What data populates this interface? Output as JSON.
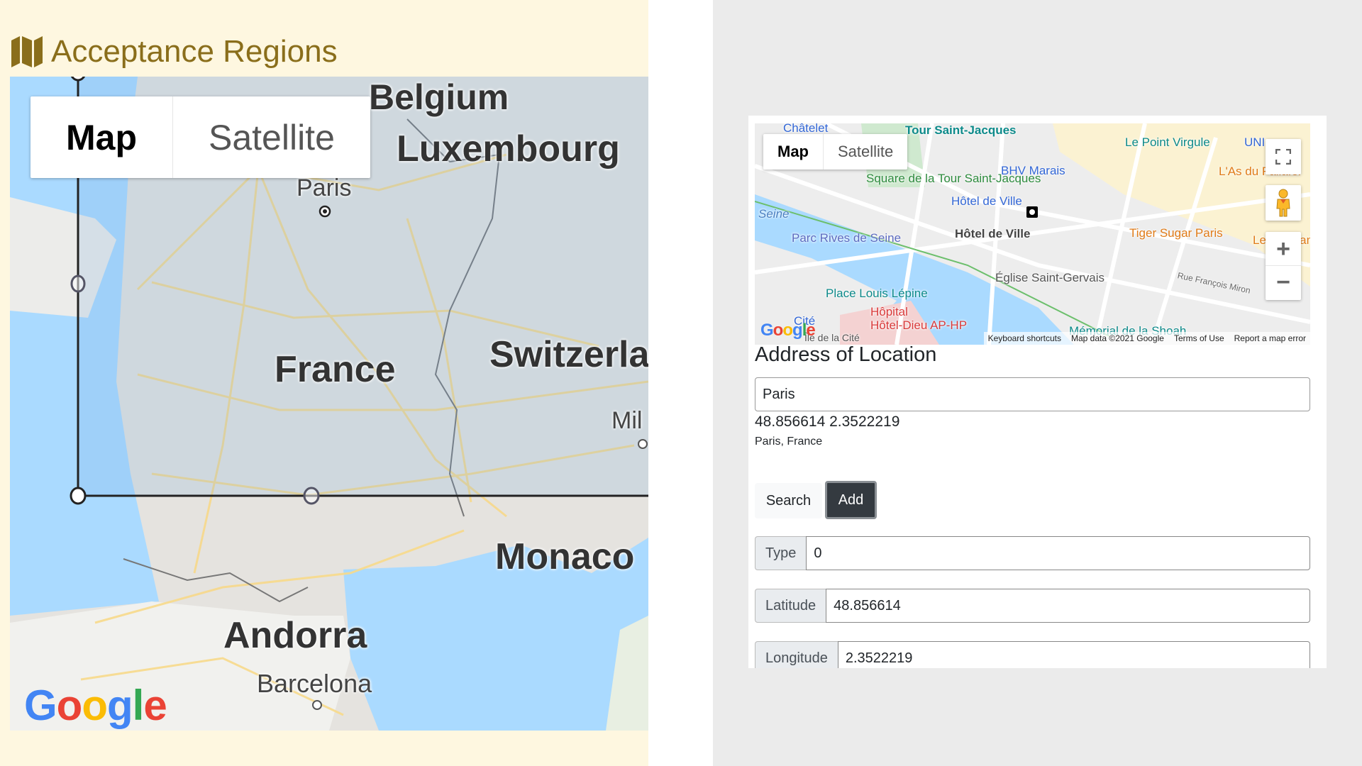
{
  "left": {
    "title": "Acceptance Regions",
    "title_icon": "map-icon",
    "map": {
      "type_buttons": [
        {
          "label": "Map",
          "active": true
        },
        {
          "label": "Satellite",
          "active": false
        }
      ],
      "labels": {
        "belgium": "Belgium",
        "luxembourg": "Luxembourg",
        "paris": "Paris",
        "france": "France",
        "switzerland": "Switzerlar",
        "milan": "Mil",
        "monaco": "Monaco",
        "andorra": "Andorra",
        "barcelona": "Barcelona"
      },
      "google_logo": [
        "G",
        "o",
        "o",
        "g",
        "l",
        "e"
      ]
    }
  },
  "right": {
    "map": {
      "type_buttons": [
        {
          "label": "Map",
          "active": true
        },
        {
          "label": "Satellite",
          "active": false
        }
      ],
      "pois": {
        "chatelet": "Châtelet",
        "tour_saint_jacques": "Tour Saint-Jacques",
        "square_tour": "Square de la Tour Saint-Jacques",
        "bhv": "BHV Marais",
        "point_virgule": "Le Point Virgule",
        "uniqlo": "UNI",
        "as_fallafel": "L'As du Fallafel",
        "hotel_ville_metro": "Hôtel de Ville",
        "hotel_ville": "Hôtel de Ville",
        "seine": "Seine",
        "parc_rives": "Parc Rives de Seine",
        "tiger_sugar": "Tiger Sugar Paris",
        "loir": "Le Loir dans",
        "eglise": "Église Saint-Gervais",
        "rue_miron": "Rue François Miron",
        "place_lepine": "Place Louis Lépine",
        "cite": "Cité",
        "hopital": "Hôpital",
        "hopital2": "Hôtel-Dieu AP-HP",
        "ile_cite": "Île de la Cité",
        "shoah": "Mémorial de la Shoah"
      },
      "attribution": [
        "Keyboard shortcuts",
        "Map data ©2021 Google",
        "Terms of Use",
        "Report a map error"
      ],
      "controls": {
        "fullscreen": "fullscreen-icon",
        "pegman": "pegman-icon",
        "zoom_in": "+",
        "zoom_out": "−"
      },
      "google_logo": [
        "G",
        "o",
        "o",
        "g",
        "l",
        "e"
      ]
    },
    "address_title": "Address of Location",
    "address_value": "Paris",
    "coords_text": "48.856614 2.3522219",
    "place_text": "Paris, France",
    "search_label": "Search",
    "add_label": "Add",
    "fields": [
      {
        "label": "Type",
        "value": "0"
      },
      {
        "label": "Latitude",
        "value": "48.856614"
      },
      {
        "label": "Longitude",
        "value": "2.3522219"
      }
    ]
  }
}
